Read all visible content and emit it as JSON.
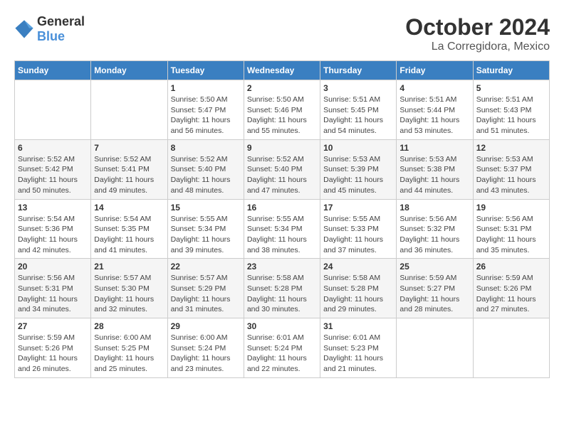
{
  "header": {
    "logo_general": "General",
    "logo_blue": "Blue",
    "month": "October 2024",
    "location": "La Corregidora, Mexico"
  },
  "weekdays": [
    "Sunday",
    "Monday",
    "Tuesday",
    "Wednesday",
    "Thursday",
    "Friday",
    "Saturday"
  ],
  "weeks": [
    [
      {
        "day": "",
        "info": ""
      },
      {
        "day": "",
        "info": ""
      },
      {
        "day": "1",
        "info": "Sunrise: 5:50 AM\nSunset: 5:47 PM\nDaylight: 11 hours and 56 minutes."
      },
      {
        "day": "2",
        "info": "Sunrise: 5:50 AM\nSunset: 5:46 PM\nDaylight: 11 hours and 55 minutes."
      },
      {
        "day": "3",
        "info": "Sunrise: 5:51 AM\nSunset: 5:45 PM\nDaylight: 11 hours and 54 minutes."
      },
      {
        "day": "4",
        "info": "Sunrise: 5:51 AM\nSunset: 5:44 PM\nDaylight: 11 hours and 53 minutes."
      },
      {
        "day": "5",
        "info": "Sunrise: 5:51 AM\nSunset: 5:43 PM\nDaylight: 11 hours and 51 minutes."
      }
    ],
    [
      {
        "day": "6",
        "info": "Sunrise: 5:52 AM\nSunset: 5:42 PM\nDaylight: 11 hours and 50 minutes."
      },
      {
        "day": "7",
        "info": "Sunrise: 5:52 AM\nSunset: 5:41 PM\nDaylight: 11 hours and 49 minutes."
      },
      {
        "day": "8",
        "info": "Sunrise: 5:52 AM\nSunset: 5:40 PM\nDaylight: 11 hours and 48 minutes."
      },
      {
        "day": "9",
        "info": "Sunrise: 5:52 AM\nSunset: 5:40 PM\nDaylight: 11 hours and 47 minutes."
      },
      {
        "day": "10",
        "info": "Sunrise: 5:53 AM\nSunset: 5:39 PM\nDaylight: 11 hours and 45 minutes."
      },
      {
        "day": "11",
        "info": "Sunrise: 5:53 AM\nSunset: 5:38 PM\nDaylight: 11 hours and 44 minutes."
      },
      {
        "day": "12",
        "info": "Sunrise: 5:53 AM\nSunset: 5:37 PM\nDaylight: 11 hours and 43 minutes."
      }
    ],
    [
      {
        "day": "13",
        "info": "Sunrise: 5:54 AM\nSunset: 5:36 PM\nDaylight: 11 hours and 42 minutes."
      },
      {
        "day": "14",
        "info": "Sunrise: 5:54 AM\nSunset: 5:35 PM\nDaylight: 11 hours and 41 minutes."
      },
      {
        "day": "15",
        "info": "Sunrise: 5:55 AM\nSunset: 5:34 PM\nDaylight: 11 hours and 39 minutes."
      },
      {
        "day": "16",
        "info": "Sunrise: 5:55 AM\nSunset: 5:34 PM\nDaylight: 11 hours and 38 minutes."
      },
      {
        "day": "17",
        "info": "Sunrise: 5:55 AM\nSunset: 5:33 PM\nDaylight: 11 hours and 37 minutes."
      },
      {
        "day": "18",
        "info": "Sunrise: 5:56 AM\nSunset: 5:32 PM\nDaylight: 11 hours and 36 minutes."
      },
      {
        "day": "19",
        "info": "Sunrise: 5:56 AM\nSunset: 5:31 PM\nDaylight: 11 hours and 35 minutes."
      }
    ],
    [
      {
        "day": "20",
        "info": "Sunrise: 5:56 AM\nSunset: 5:31 PM\nDaylight: 11 hours and 34 minutes."
      },
      {
        "day": "21",
        "info": "Sunrise: 5:57 AM\nSunset: 5:30 PM\nDaylight: 11 hours and 32 minutes."
      },
      {
        "day": "22",
        "info": "Sunrise: 5:57 AM\nSunset: 5:29 PM\nDaylight: 11 hours and 31 minutes."
      },
      {
        "day": "23",
        "info": "Sunrise: 5:58 AM\nSunset: 5:28 PM\nDaylight: 11 hours and 30 minutes."
      },
      {
        "day": "24",
        "info": "Sunrise: 5:58 AM\nSunset: 5:28 PM\nDaylight: 11 hours and 29 minutes."
      },
      {
        "day": "25",
        "info": "Sunrise: 5:59 AM\nSunset: 5:27 PM\nDaylight: 11 hours and 28 minutes."
      },
      {
        "day": "26",
        "info": "Sunrise: 5:59 AM\nSunset: 5:26 PM\nDaylight: 11 hours and 27 minutes."
      }
    ],
    [
      {
        "day": "27",
        "info": "Sunrise: 5:59 AM\nSunset: 5:26 PM\nDaylight: 11 hours and 26 minutes."
      },
      {
        "day": "28",
        "info": "Sunrise: 6:00 AM\nSunset: 5:25 PM\nDaylight: 11 hours and 25 minutes."
      },
      {
        "day": "29",
        "info": "Sunrise: 6:00 AM\nSunset: 5:24 PM\nDaylight: 11 hours and 23 minutes."
      },
      {
        "day": "30",
        "info": "Sunrise: 6:01 AM\nSunset: 5:24 PM\nDaylight: 11 hours and 22 minutes."
      },
      {
        "day": "31",
        "info": "Sunrise: 6:01 AM\nSunset: 5:23 PM\nDaylight: 11 hours and 21 minutes."
      },
      {
        "day": "",
        "info": ""
      },
      {
        "day": "",
        "info": ""
      }
    ]
  ]
}
